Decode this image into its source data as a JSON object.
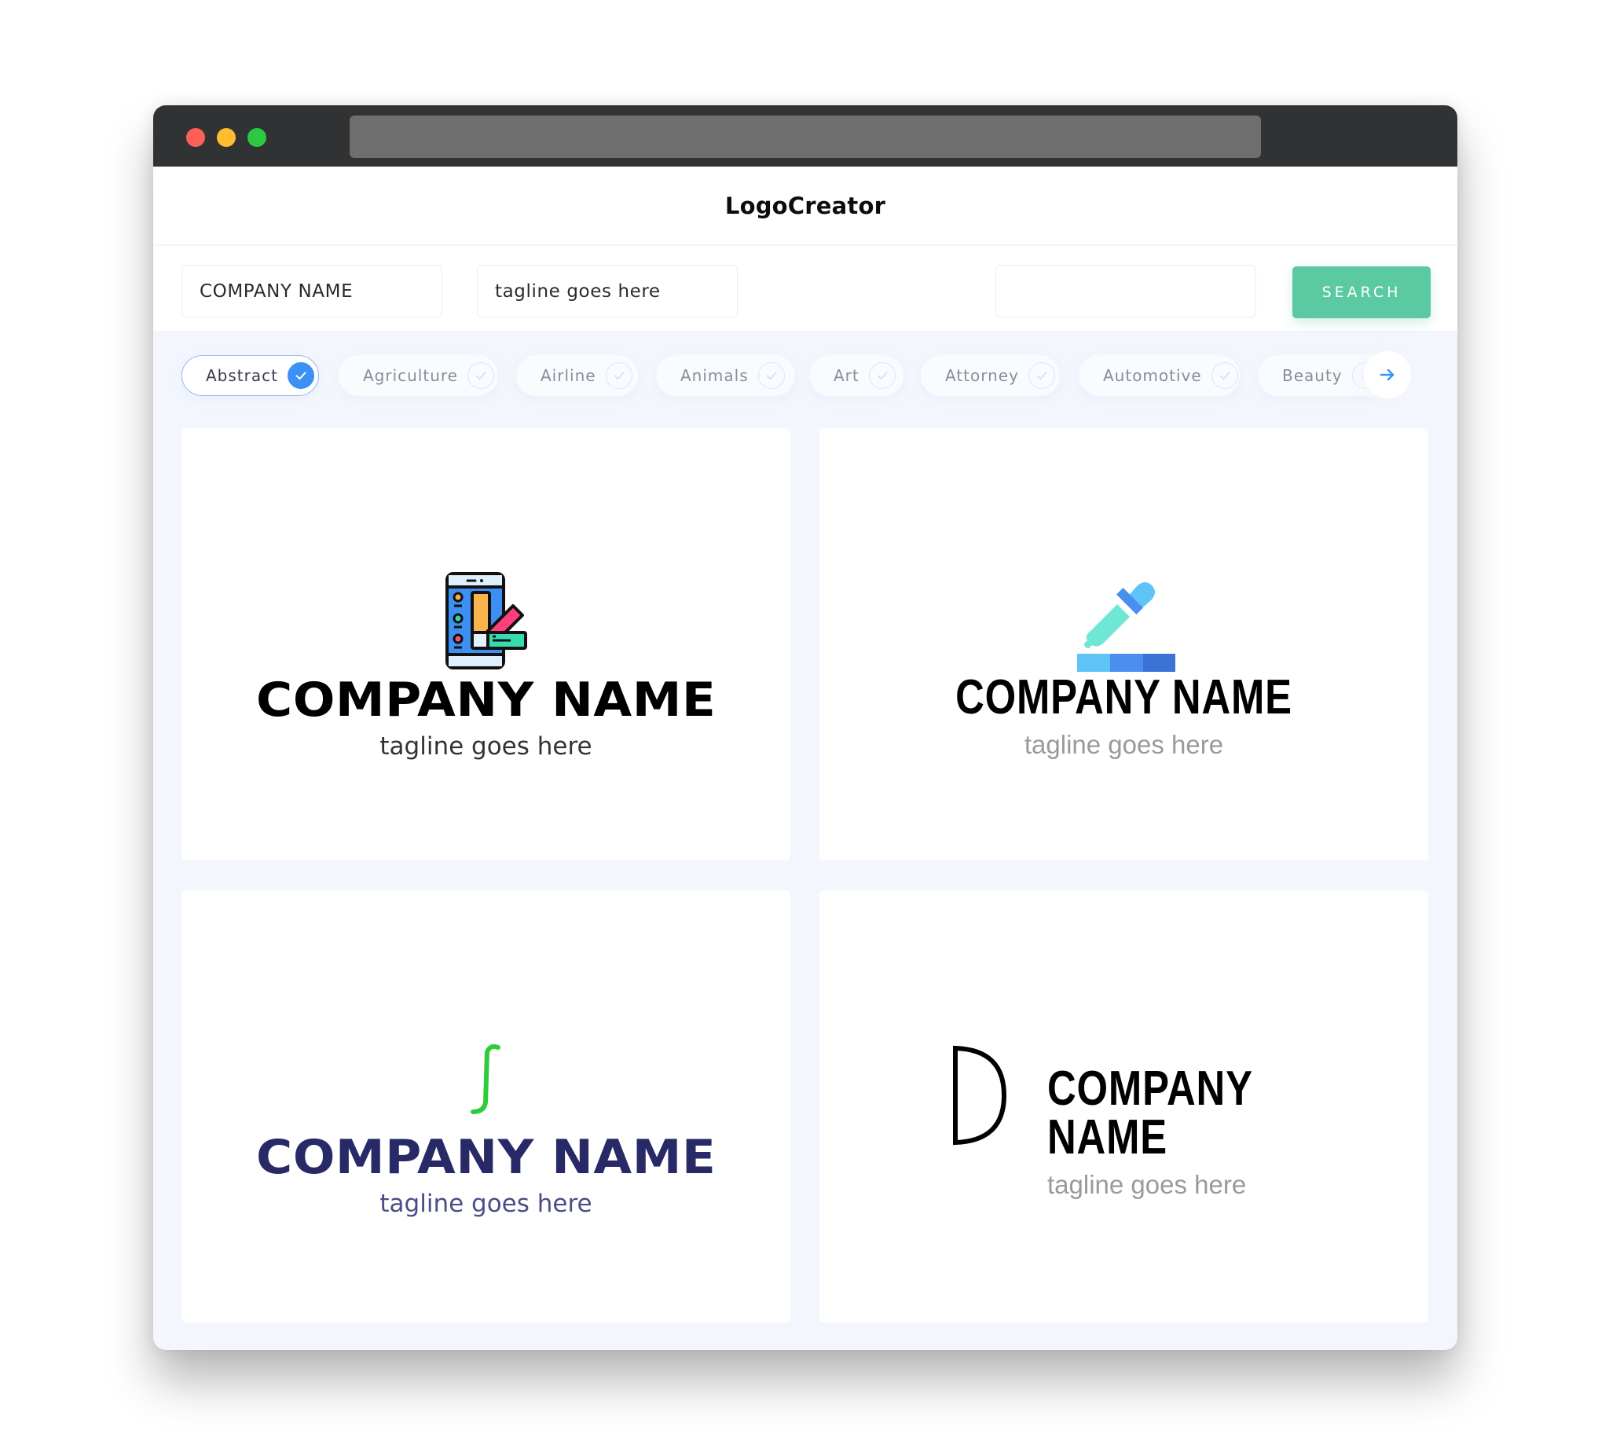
{
  "browser": {
    "traffic_lights": [
      "close",
      "minimize",
      "maximize"
    ],
    "colors": {
      "close": "#fe5f57",
      "minimize": "#febc2e",
      "maximize": "#2cc840",
      "chrome": "#313234",
      "address_bar": "#6e6e6e"
    }
  },
  "header": {
    "title": "LogoCreator"
  },
  "search": {
    "company_name_value": "COMPANY NAME",
    "tagline_value": "tagline goes here",
    "keyword_value": "",
    "button_label": "SEARCH",
    "button_color": "#5bc9a1"
  },
  "filters": {
    "items": [
      {
        "label": "Abstract",
        "selected": true
      },
      {
        "label": "Agriculture",
        "selected": false
      },
      {
        "label": "Airline",
        "selected": false
      },
      {
        "label": "Animals",
        "selected": false
      },
      {
        "label": "Art",
        "selected": false
      },
      {
        "label": "Attorney",
        "selected": false
      },
      {
        "label": "Automotive",
        "selected": false
      },
      {
        "label": "Beauty",
        "selected": false
      }
    ],
    "next_icon": "arrow-right-icon",
    "accent": "#3b91f4"
  },
  "logos": [
    {
      "company": "COMPANY NAME",
      "tagline": "tagline goes here",
      "icon": "phone-color-palette-icon",
      "name_color": "#000000",
      "tagline_color": "#333333"
    },
    {
      "company": "COMPANY NAME",
      "tagline": "tagline goes here",
      "icon": "eyedropper-swatch-icon",
      "name_color": "#000000",
      "tagline_color": "#9a9a9a"
    },
    {
      "company": "COMPANY NAME",
      "tagline": "tagline goes here",
      "icon": "integral-curve-icon",
      "name_color": "#272a66",
      "tagline_color": "#4b4e86",
      "icon_color": "#2fcc3a"
    },
    {
      "company": "COMPANY NAME",
      "tagline": "tagline goes here",
      "icon": "half-circle-d-icon",
      "name_color": "#000000",
      "tagline_color": "#9a9a9a"
    }
  ]
}
